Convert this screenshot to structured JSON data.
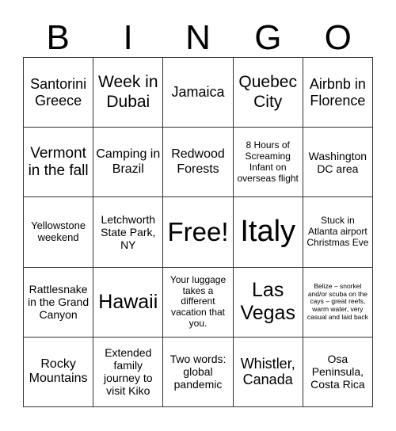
{
  "title_letters": [
    "B",
    "I",
    "N",
    "G",
    "O"
  ],
  "cells": [
    "Santorini Greece",
    "Week in Dubai",
    "Jamaica",
    "Quebec City",
    "Airbnb in Florence",
    "Vermont in the fall",
    "Camping in Brazil",
    "Redwood Forests",
    "8 Hours of Screaming Infant on overseas flight",
    "Washington DC area",
    "Yellowstone weekend",
    "Letchworth State Park, NY",
    "Free!",
    "Italy",
    "Stuck in Atlanta airport Christmas Eve",
    "Rattlesnake in the Grand Canyon",
    "Hawaii",
    "Your luggage takes a different vacation that you.",
    "Las Vegas",
    "Belize – snorkel and/or scuba on the cays – great reefs, warm water, very casual and laid back",
    "Rocky Mountains",
    "Extended family journey to visit Kiko",
    "Two words: global pandemic",
    "Whistler, Canada",
    "Osa Peninsula, Costa Rica"
  ]
}
